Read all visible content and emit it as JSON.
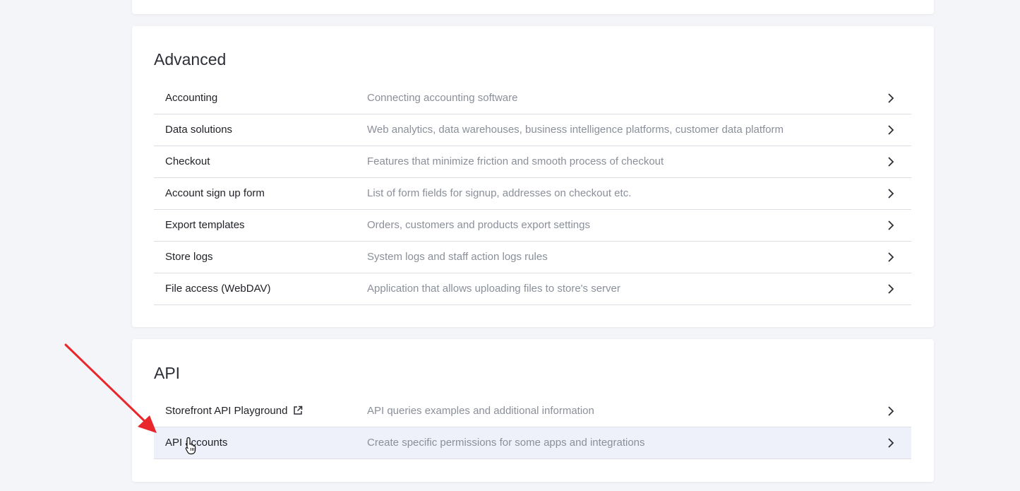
{
  "advanced": {
    "title": "Advanced",
    "items": [
      {
        "label": "Accounting",
        "description": "Connecting accounting software"
      },
      {
        "label": "Data solutions",
        "description": "Web analytics, data warehouses, business intelligence platforms, customer data platform"
      },
      {
        "label": "Checkout",
        "description": "Features that minimize friction and smooth process of checkout"
      },
      {
        "label": "Account sign up form",
        "description": "List of form fields for signup, addresses on checkout etc."
      },
      {
        "label": "Export templates",
        "description": "Orders, customers and products export settings"
      },
      {
        "label": "Store logs",
        "description": "System logs and staff action logs rules"
      },
      {
        "label": "File access (WebDAV)",
        "description": "Application that allows uploading files to store's server"
      }
    ]
  },
  "api": {
    "title": "API",
    "items": [
      {
        "label": "Storefront API Playground",
        "description": "API queries examples and additional information",
        "icon": "external-link-icon"
      },
      {
        "label": "API accounts",
        "description": "Create specific permissions for some apps and integrations",
        "state": "hovered"
      }
    ]
  },
  "icons": {
    "row_chevron": "chevron-right-icon",
    "annotation": "red-arrow-annotation",
    "cursor": "hand-pointer-cursor"
  },
  "colors": {
    "background": "#f4f5f8",
    "card": "#ffffff",
    "hover_row": "#eef1fa",
    "annotation_arrow": "#e8262b"
  }
}
